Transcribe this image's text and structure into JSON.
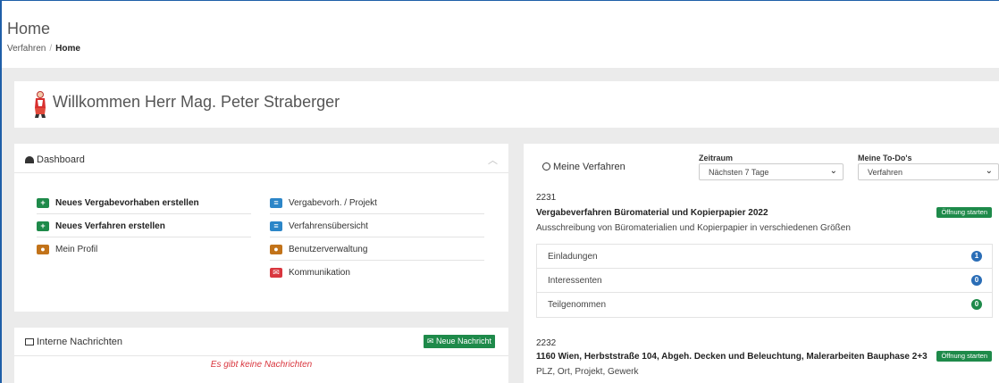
{
  "header": {
    "title": "Home",
    "breadcrumb": [
      "Verfahren",
      "Home"
    ]
  },
  "welcome": {
    "text": "Willkommen Herr Mag. Peter Straberger"
  },
  "dashboard": {
    "title": "Dashboard",
    "left_links": [
      {
        "label": "Neues Vergabevorhaben erstellen",
        "icon": "plus-icon",
        "color": "#1e8a4a"
      },
      {
        "label": "Neues Verfahren erstellen",
        "icon": "plus-icon",
        "color": "#1e8a4a"
      },
      {
        "label": "Mein Profil",
        "icon": "user-icon",
        "color": "#c2731a"
      }
    ],
    "right_links": [
      {
        "label": "Vergabevorh. / Projekt",
        "icon": "list-icon",
        "color": "#2c86c8"
      },
      {
        "label": "Verfahrensübersicht",
        "icon": "list-icon",
        "color": "#2c86c8"
      },
      {
        "label": "Benutzerverwaltung",
        "icon": "users-icon",
        "color": "#c2731a"
      },
      {
        "label": "Kommunikation",
        "icon": "envelope-icon",
        "color": "#d9363e"
      }
    ]
  },
  "messages": {
    "title": "Interne Nachrichten",
    "new_button": "Neue Nachricht",
    "empty_text": "Es gibt keine Nachrichten"
  },
  "verfahren": {
    "title": "Meine Verfahren",
    "zeitraum": {
      "label": "Zeitraum",
      "value": "Nächsten 7 Tage"
    },
    "todos": {
      "label": "Meine To-Do's",
      "value": "Verfahren"
    },
    "items": [
      {
        "no": "2231",
        "title": "Vergabeverfahren Büromaterial und Kopierpapier 2022",
        "description": "Ausschreibung von Büromaterialien und Kopierpapier in verschiedenen Größen",
        "badge": "Öffnung starten",
        "stats": [
          {
            "label": "Einladungen",
            "count": "1",
            "color": "#2a6db6"
          },
          {
            "label": "Interessenten",
            "count": "0",
            "color": "#2a6db6"
          },
          {
            "label": "Teilgenommen",
            "count": "0",
            "color": "#1e8a4a"
          }
        ]
      },
      {
        "no": "2232",
        "title": "1160 Wien, Herbststraße 104, Abgeh. Decken und Beleuchtung, Malerarbeiten Bauphase 2+3",
        "description": "PLZ, Ort, Projekt, Gewerk",
        "badge": "Öffnung starten"
      }
    ]
  }
}
